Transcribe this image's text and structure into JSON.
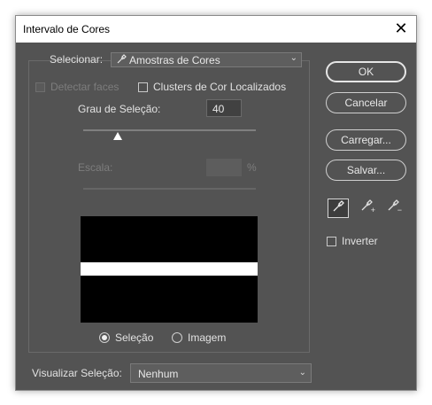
{
  "window": {
    "title": "Intervalo de Cores",
    "close_glyph": "✕"
  },
  "select_row": {
    "label": "Selecionar:",
    "value": "Amostras de Cores",
    "icon": "eyedropper-icon",
    "chevron": "⌄"
  },
  "options": {
    "detect_faces": "Detectar faces",
    "localized_clusters": "Clusters de Cor Localizados"
  },
  "fuzziness": {
    "label": "Grau de Seleção:",
    "value": "40",
    "slider_fraction": 0.2
  },
  "range": {
    "label": "Escala:",
    "value": "",
    "unit": "%"
  },
  "preview_mode": {
    "selection_label": "Seleção",
    "image_label": "Imagem",
    "selected": "selection"
  },
  "buttons": {
    "ok": "OK",
    "cancel": "Cancelar",
    "load": "Carregar...",
    "save": "Salvar..."
  },
  "eyedroppers": {
    "sample": "eyedropper-icon",
    "add": "eyedropper-plus-icon",
    "subtract": "eyedropper-minus-icon",
    "add_sign": "+",
    "subtract_sign": "−"
  },
  "invert": {
    "label": "Inverter",
    "checked": false
  },
  "preview_selection": {
    "label": "Visualizar Seleção:",
    "value": "Nenhum",
    "chevron": "⌄"
  },
  "colors": {
    "dialog_bg": "#535353",
    "titlebar": "#ffffff",
    "text": "#dcdcdc"
  }
}
